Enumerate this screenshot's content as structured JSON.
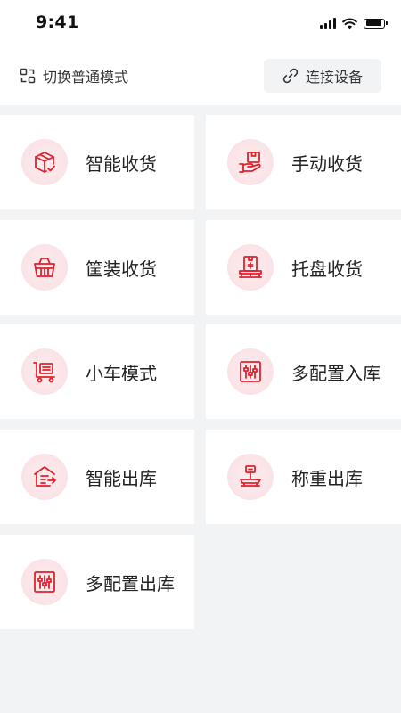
{
  "status_bar": {
    "time": "9:41"
  },
  "header": {
    "switch_label": "切换普通模式",
    "connect_label": "连接设备"
  },
  "accent_color": "#e0222e",
  "menu": [
    {
      "label": "智能收货",
      "icon": "box-check-icon"
    },
    {
      "label": "手动收货",
      "icon": "hand-box-icon"
    },
    {
      "label": "筐装收货",
      "icon": "basket-icon"
    },
    {
      "label": "托盘收货",
      "icon": "pallet-icon"
    },
    {
      "label": "小车模式",
      "icon": "cart-icon"
    },
    {
      "label": "多配置入库",
      "icon": "sliders-icon"
    },
    {
      "label": "智能出库",
      "icon": "warehouse-out-icon"
    },
    {
      "label": "称重出库",
      "icon": "scale-icon"
    },
    {
      "label": "多配置出库",
      "icon": "sliders-icon"
    }
  ]
}
